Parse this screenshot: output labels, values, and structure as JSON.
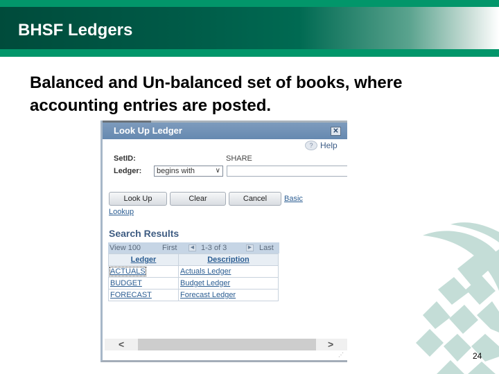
{
  "slide": {
    "title": "BHSF Ledgers",
    "subtitle": "Balanced and Un-balanced set of books, where accounting entries are posted.",
    "page_number": "24",
    "colors": {
      "brand_green": "#02966a",
      "brand_dark": "#004b3b"
    }
  },
  "dialog": {
    "title": "Look Up Ledger",
    "close_icon": "close-icon",
    "help_label": "Help",
    "help_icon": "?",
    "setid_label": "SetID:",
    "setid_value": "SHARE",
    "ledger_label": "Ledger:",
    "ledger_operator": "begins with",
    "ledger_value": "",
    "buttons": {
      "lookup": "Look Up",
      "clear": "Clear",
      "cancel": "Cancel"
    },
    "basic_lookup_1": "Basic",
    "basic_lookup_2": "Lookup",
    "results_title": "Search Results",
    "nav": {
      "view": "View 100",
      "first": "First",
      "range": "1-3 of 3",
      "last": "Last"
    },
    "columns": [
      "Ledger",
      "Description"
    ],
    "rows": [
      {
        "ledger": "ACTUALS",
        "description": "Actuals Ledger"
      },
      {
        "ledger": "BUDGET",
        "description": "Budget Ledger"
      },
      {
        "ledger": "FORECAST",
        "description": "Forecast Ledger"
      }
    ]
  }
}
